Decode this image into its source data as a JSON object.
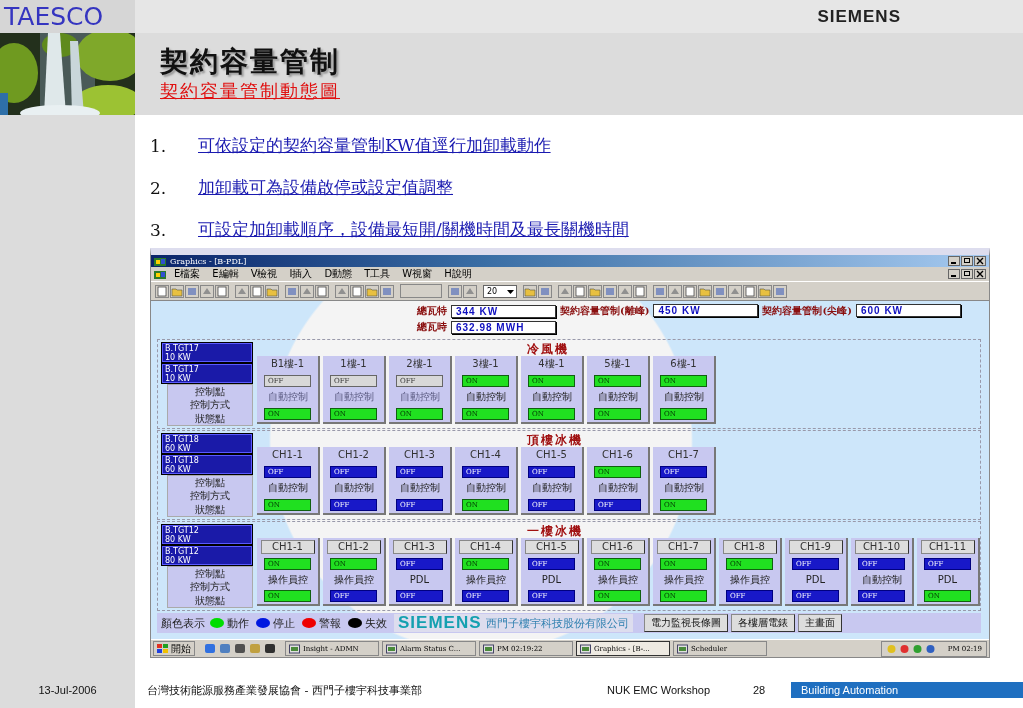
{
  "slide": {
    "brand": "TAESCO",
    "logo": "SIEMENS",
    "title": "契約容量管制",
    "subtitle": "契約容量管制動態圖",
    "points": [
      {
        "number": "1.",
        "text": "可依設定的契約容量管制KW值逕行加卸載動作"
      },
      {
        "number": "2.",
        "text": "加卸載可為設備啟停或設定值調整"
      },
      {
        "number": "3.",
        "text": "可設定加卸載順序，設備最短開/關機時間及最長關機時間"
      }
    ]
  },
  "window": {
    "title": "Graphics - [B-PDL]",
    "menu": [
      "E檔案",
      "E編輯",
      "V檢視",
      "I插入",
      "D動態",
      "T工具",
      "W視窗",
      "H說明"
    ],
    "zoom_value": "20",
    "totals": [
      {
        "label": "總瓦特",
        "value": "344 KW"
      },
      {
        "label": "總瓦時",
        "value": "632.98 MWH"
      }
    ],
    "limits": [
      {
        "label": "契約容量管制(離峰)",
        "value": "450 KW"
      },
      {
        "label": "契約容量管制(尖峰)",
        "value": "600 KW"
      }
    ],
    "sections": [
      {
        "title": "冷風機",
        "kind": "plain",
        "meters": [
          {
            "name": "B.TGT17",
            "load": "10 KW"
          },
          {
            "name": "B.TGT17",
            "load": "10 KW"
          }
        ],
        "row_labels": [
          "控制點",
          "控制方式",
          "狀態點"
        ],
        "units": [
          {
            "name": "B1樓-1",
            "control": {
              "label": "OFF",
              "on": false,
              "disabled": true
            },
            "mode": {
              "text": "自動控制",
              "disabled": true
            },
            "status": {
              "label": "ON",
              "on": true,
              "disabled": false
            }
          },
          {
            "name": "1樓-1",
            "control": {
              "label": "OFF",
              "on": false,
              "disabled": true
            },
            "mode": {
              "text": "自動控制",
              "disabled": true
            },
            "status": {
              "label": "ON",
              "on": true,
              "disabled": false
            }
          },
          {
            "name": "2樓-1",
            "control": {
              "label": "OFF",
              "on": false,
              "disabled": true
            },
            "mode": {
              "text": "自動控制",
              "disabled": true
            },
            "status": {
              "label": "ON",
              "on": true,
              "disabled": false
            }
          },
          {
            "name": "3樓-1",
            "control": {
              "label": "ON",
              "on": true,
              "disabled": false
            },
            "mode": {
              "text": "自動控制",
              "disabled": false
            },
            "status": {
              "label": "ON",
              "on": true,
              "disabled": false
            }
          },
          {
            "name": "4樓-1",
            "control": {
              "label": "ON",
              "on": true,
              "disabled": false
            },
            "mode": {
              "text": "自動控制",
              "disabled": false
            },
            "status": {
              "label": "ON",
              "on": true,
              "disabled": false
            }
          },
          {
            "name": "5樓-1",
            "control": {
              "label": "ON",
              "on": true,
              "disabled": false
            },
            "mode": {
              "text": "自動控制",
              "disabled": false
            },
            "status": {
              "label": "ON",
              "on": true,
              "disabled": false
            }
          },
          {
            "name": "6樓-1",
            "control": {
              "label": "ON",
              "on": true,
              "disabled": false
            },
            "mode": {
              "text": "自動控制",
              "disabled": false
            },
            "status": {
              "label": "ON",
              "on": true,
              "disabled": false
            }
          }
        ]
      },
      {
        "title": "頂樓冰機",
        "kind": "plain",
        "meters": [
          {
            "name": "B.TGT18",
            "load": "60 KW"
          },
          {
            "name": "B.TGT18",
            "load": "60 KW"
          }
        ],
        "row_labels": [
          "控制點",
          "控制方式",
          "狀態點"
        ],
        "units": [
          {
            "name": "CH1-1",
            "control": {
              "label": "OFF",
              "on": false,
              "disabled": false
            },
            "mode": {
              "text": "自動控制",
              "disabled": false
            },
            "status": {
              "label": "ON",
              "on": true,
              "disabled": false
            }
          },
          {
            "name": "CH1-2",
            "control": {
              "label": "OFF",
              "on": false,
              "disabled": false
            },
            "mode": {
              "text": "自動控制",
              "disabled": false
            },
            "status": {
              "label": "OFF",
              "on": false,
              "disabled": false
            }
          },
          {
            "name": "CH1-3",
            "control": {
              "label": "OFF",
              "on": false,
              "disabled": false
            },
            "mode": {
              "text": "自動控制",
              "disabled": false
            },
            "status": {
              "label": "OFF",
              "on": false,
              "disabled": false
            }
          },
          {
            "name": "CH1-4",
            "control": {
              "label": "OFF",
              "on": false,
              "disabled": false
            },
            "mode": {
              "text": "自動控制",
              "disabled": false
            },
            "status": {
              "label": "ON",
              "on": true,
              "disabled": false
            }
          },
          {
            "name": "CH1-5",
            "control": {
              "label": "OFF",
              "on": false,
              "disabled": false
            },
            "mode": {
              "text": "自動控制",
              "disabled": false
            },
            "status": {
              "label": "OFF",
              "on": false,
              "disabled": false
            }
          },
          {
            "name": "CH1-6",
            "control": {
              "label": "ON",
              "on": true,
              "disabled": false
            },
            "mode": {
              "text": "自動控制",
              "disabled": false
            },
            "status": {
              "label": "OFF",
              "on": false,
              "disabled": false
            }
          },
          {
            "name": "CH1-7",
            "control": {
              "label": "OFF",
              "on": false,
              "disabled": false
            },
            "mode": {
              "text": "自動控制",
              "disabled": false
            },
            "status": {
              "label": "ON",
              "on": true,
              "disabled": false
            }
          }
        ]
      },
      {
        "title": "一樓冰機",
        "kind": "tab",
        "meters": [
          {
            "name": "B.TGT12",
            "load": "80 KW"
          },
          {
            "name": "B.TGT12",
            "load": "80 KW"
          }
        ],
        "row_labels": [
          "控制點",
          "控制方式",
          "狀態點"
        ],
        "units": [
          {
            "name": "CH1-1",
            "control": {
              "label": "ON",
              "on": true,
              "disabled": false
            },
            "mode": {
              "text": "操作員控",
              "disabled": false
            },
            "status": {
              "label": "ON",
              "on": true,
              "disabled": false
            }
          },
          {
            "name": "CH1-2",
            "control": {
              "label": "ON",
              "on": true,
              "disabled": false
            },
            "mode": {
              "text": "操作員控",
              "disabled": false
            },
            "status": {
              "label": "OFF",
              "on": false,
              "disabled": false
            }
          },
          {
            "name": "CH1-3",
            "control": {
              "label": "OFF",
              "on": false,
              "disabled": false
            },
            "mode": {
              "text": "PDL",
              "disabled": false
            },
            "status": {
              "label": "OFF",
              "on": false,
              "disabled": false
            }
          },
          {
            "name": "CH1-4",
            "control": {
              "label": "ON",
              "on": true,
              "disabled": false
            },
            "mode": {
              "text": "操作員控",
              "disabled": false
            },
            "status": {
              "label": "OFF",
              "on": false,
              "disabled": false
            }
          },
          {
            "name": "CH1-5",
            "control": {
              "label": "OFF",
              "on": false,
              "disabled": false
            },
            "mode": {
              "text": "PDL",
              "disabled": false
            },
            "status": {
              "label": "OFF",
              "on": false,
              "disabled": false
            }
          },
          {
            "name": "CH1-6",
            "control": {
              "label": "ON",
              "on": true,
              "disabled": false
            },
            "mode": {
              "text": "操作員控",
              "disabled": false
            },
            "status": {
              "label": "ON",
              "on": true,
              "disabled": false
            }
          },
          {
            "name": "CH1-7",
            "control": {
              "label": "ON",
              "on": true,
              "disabled": false
            },
            "mode": {
              "text": "操作員控",
              "disabled": false
            },
            "status": {
              "label": "ON",
              "on": true,
              "disabled": false
            }
          },
          {
            "name": "CH1-8",
            "control": {
              "label": "ON",
              "on": true,
              "disabled": false
            },
            "mode": {
              "text": "操作員控",
              "disabled": false
            },
            "status": {
              "label": "OFF",
              "on": false,
              "disabled": false
            }
          },
          {
            "name": "CH1-9",
            "control": {
              "label": "OFF",
              "on": false,
              "disabled": false
            },
            "mode": {
              "text": "PDL",
              "disabled": false
            },
            "status": {
              "label": "OFF",
              "on": false,
              "disabled": false
            }
          },
          {
            "name": "CH1-10",
            "control": {
              "label": "OFF",
              "on": false,
              "disabled": false
            },
            "mode": {
              "text": "自動控制",
              "disabled": false
            },
            "status": {
              "label": "OFF",
              "on": false,
              "disabled": false
            }
          },
          {
            "name": "CH1-11",
            "control": {
              "label": "OFF",
              "on": false,
              "disabled": false
            },
            "mode": {
              "text": "PDL",
              "disabled": false
            },
            "status": {
              "label": "ON",
              "on": true,
              "disabled": false
            }
          }
        ]
      }
    ],
    "legend": {
      "title": "顏色表示",
      "items": [
        {
          "label": "動作",
          "color": "#00dd00"
        },
        {
          "label": "停止",
          "color": "#0018e0"
        },
        {
          "label": "警報",
          "color": "#ee0000"
        },
        {
          "label": "失效",
          "color": "#000000"
        }
      ]
    },
    "company": {
      "logo": "SIEMENS",
      "name": "西門子樓宇科技股份有限公司"
    },
    "nav_buttons": [
      "電力監視長條圖",
      "各樓層電錶",
      "主畫面"
    ],
    "taskbar": {
      "start": "開始",
      "tasks": [
        {
          "label": "Insight - ADMN",
          "selected": false
        },
        {
          "label": "Alarm Status C...",
          "selected": false
        },
        {
          "label": "PM 02:19:22",
          "selected": false
        },
        {
          "label": "Graphics - [B-...",
          "selected": true
        },
        {
          "label": "Scheduler",
          "selected": false
        }
      ],
      "clock": "PM 02:19"
    }
  },
  "footer": {
    "date": "13-Jul-2006",
    "organization": "台灣技術能源服務產業發展協會 - 西門子樓宇科技事業部",
    "event": "NUK EMC Workshop",
    "page": "28",
    "tag": "Building Automation"
  }
}
